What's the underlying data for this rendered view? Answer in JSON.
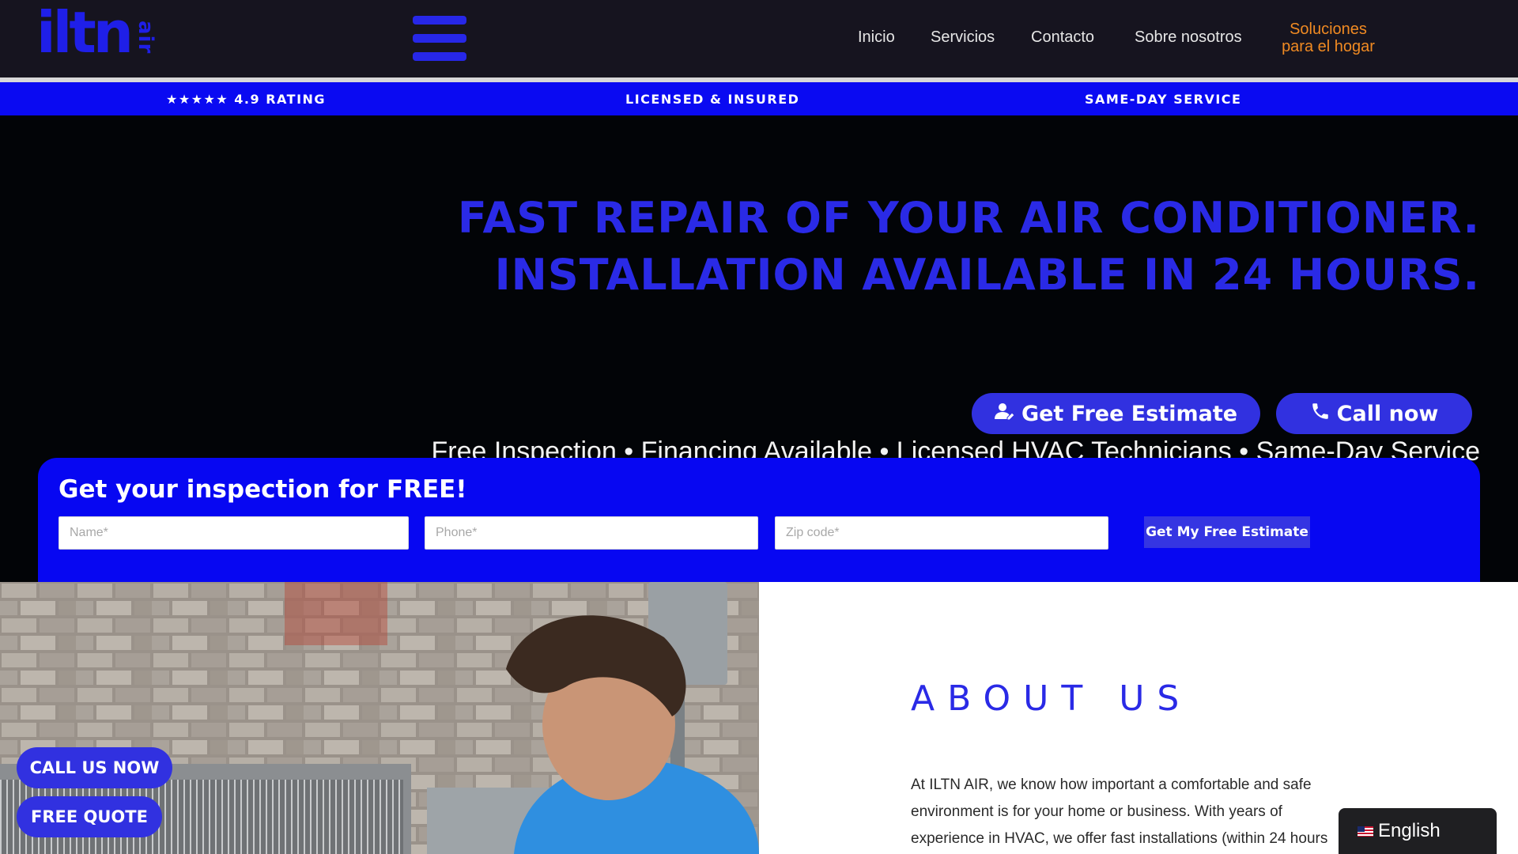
{
  "header": {
    "logo_main": "iltn",
    "logo_sub": "air",
    "nav": [
      {
        "label": "Inicio"
      },
      {
        "label": "Servicios"
      },
      {
        "label": "Contacto"
      },
      {
        "label": "Sobre nosotros"
      }
    ],
    "highlight": {
      "line1": "Soluciones",
      "line2": "para el hogar"
    },
    "accent_color": "#f08a22"
  },
  "trust_bar": {
    "stars": "★★★★★",
    "items": [
      "4.9 RATING",
      "LICENSED & INSURED",
      "SAME-DAY SERVICE"
    ],
    "color": "#0a0af2"
  },
  "hero": {
    "headline_line1": "FAST REPAIR OF YOUR AIR CONDITIONER.",
    "headline_line2": "INSTALLATION AVAILABLE IN 24 HOURS.",
    "subline": "Free Inspection • Financing Available • Licensed HVAC Technicians • Same-Day Service",
    "buttons": [
      {
        "label": "Get Free Estimate",
        "icon": "user-edit-icon"
      },
      {
        "label": "Call now",
        "icon": "phone-icon"
      }
    ],
    "headline_color": "#2a2ae6"
  },
  "form": {
    "title": "Get your inspection for FREE!",
    "fields": [
      {
        "placeholder": "Name*"
      },
      {
        "placeholder": "Phone*"
      },
      {
        "placeholder": "Zip code*"
      }
    ],
    "submit_label": "Get My Free Estimate"
  },
  "about": {
    "title": "ABOUT US",
    "lines": [
      "At ILTN AIR, we know how important a comfortable and safe",
      "environment is for your home or business. With years of",
      "experience in HVAC, we offer fast installations (within 24 hours"
    ]
  },
  "floating": {
    "call_label": "CALL US NOW",
    "quote_label": "FREE QUOTE"
  },
  "language": {
    "label": "English",
    "flag": "us-flag-icon"
  }
}
